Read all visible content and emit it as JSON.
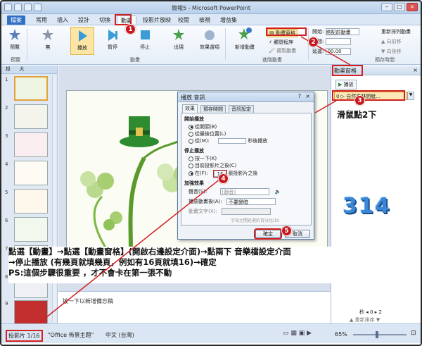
{
  "window": {
    "title": "簡報5 - Microsoft PowerPoint"
  },
  "tabs": [
    "檔案",
    "常用",
    "插入",
    "設計",
    "切換",
    "動畫",
    "投影片放映",
    "校閱",
    "檢視",
    "增益集"
  ],
  "ribbon": {
    "preview": "預覽",
    "effects": [
      "無",
      "播放",
      "暫停",
      "停止",
      "出現",
      "效果選項"
    ],
    "add_animation": "新增動畫",
    "animation_pane_btn": "動畫窗格",
    "trigger": "觸發程序",
    "copy_anim": "複製動畫",
    "start_label": "開始:",
    "start_value": "搭配前動畫",
    "duration_label": "期間:",
    "delay_label": "延遲:",
    "delay_value": "00.00",
    "reorder_title": "重新排列動畫",
    "move_earlier": "向前移",
    "move_later": "向後移",
    "group_preview": "預覽",
    "group_animation": "動畫",
    "group_advanced": "進階動畫",
    "group_timing": "預存時間"
  },
  "left_tabs": {
    "slides": "投",
    "outline": "大"
  },
  "slide_numbers": [
    "1",
    "2",
    "3",
    "4",
    "5",
    "6",
    "7",
    "8",
    "9"
  ],
  "pane": {
    "title": "動畫窗格",
    "play": "播放",
    "item": "0 ▷ 自然森林間艇...",
    "close": "×",
    "seconds": "秒",
    "reorder": "重新排序",
    "scale": [
      "0",
      "2"
    ]
  },
  "dialog": {
    "title": "播放 音訊",
    "help": "?",
    "close": "×",
    "tabs": [
      "效果",
      "預存時間",
      "音訊設定"
    ],
    "start_playing": "開始播放",
    "opt_from_beginning": "從開頭(B)",
    "opt_from_last": "從最後位置(L)",
    "opt_from_time": "從(M):",
    "seconds_label": "秒後播放",
    "stop_playing": "停止播放",
    "opt_on_click": "按一下(K)",
    "opt_after_current": "目前投影片之後(C)",
    "opt_after": "在(F):",
    "after_value": "16",
    "slides_label": "張投影片之後",
    "enhancements": "加強效果",
    "sound_label": "聲音(S):",
    "sound_value": "[靜音]",
    "after_anim_label": "播放動畫後(A):",
    "after_anim_value": "不要變暗",
    "animate_text_label": "動畫文字(X):",
    "delay_between": "字母之間延遲的百分比(D)",
    "ok": "確定",
    "cancel": "取消"
  },
  "callout_text": "滑鼠點2下",
  "callout_number": "314",
  "instructions": [
    "點選【動畫】→點選【動畫窗格】(開啟右邊設定介面)→點兩下 音樂檔設定介面",
    "→停止播放 (有幾頁就填幾頁，例如有16頁就填16)→確定",
    "PS:這個步驟很重要 ，才不會卡在第一張不動"
  ],
  "notes_placeholder": "按一下以新增備忘稿",
  "status": {
    "slide_info": "投影片 1/16",
    "theme": "\"Office 佈景主題\"",
    "language": "中文 (台灣)",
    "zoom": "65%"
  },
  "steps": [
    "1",
    "2",
    "3",
    "4",
    "5"
  ],
  "colors": {
    "accent": "#c8161d",
    "file_tab": "#2f6fc4"
  }
}
